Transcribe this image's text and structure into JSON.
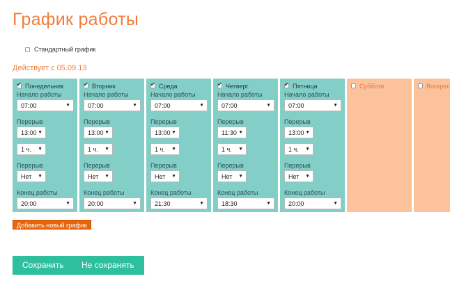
{
  "title": "График работы",
  "standard_schedule": {
    "label": "Стандартный график",
    "checked": false
  },
  "effective_label": "Действует с 05.09.13",
  "labels": {
    "start": "Начало работы",
    "break": "Перерыв",
    "end": "Конец работы"
  },
  "days": [
    {
      "name": "Понедельник",
      "checked": true,
      "start": "07:00",
      "break1": "13:00",
      "duration": "1 ч.",
      "break2": "Нет",
      "end": "20:00"
    },
    {
      "name": "Вторник",
      "checked": true,
      "start": "07:00",
      "break1": "13:00",
      "duration": "1 ч.",
      "break2": "Нет",
      "end": "20:00"
    },
    {
      "name": "Среда",
      "checked": true,
      "start": "07:00",
      "break1": "13:00",
      "duration": "1 ч.",
      "break2": "Нет",
      "end": "21:30"
    },
    {
      "name": "Четверг",
      "checked": true,
      "start": "07:00",
      "break1": "11:30",
      "duration": "1 ч.",
      "break2": "Нет",
      "end": "18:30"
    },
    {
      "name": "Пятница",
      "checked": true,
      "start": "07:00",
      "break1": "13:00",
      "duration": "1 ч.",
      "break2": "Нет",
      "end": "20:00"
    },
    {
      "name": "Суббота",
      "checked": false
    },
    {
      "name": "Воскресенье",
      "checked": false
    }
  ],
  "add_schedule_button": "Добавить новый график",
  "save_button": "Сохранить",
  "dont_save_button": "Не сохранять",
  "colors": {
    "accent_orange": "#f07d3c",
    "work_day": "#83cfc7",
    "day_off": "#fbc29b",
    "button_teal": "#2dbf9e",
    "button_orange": "#e8650a"
  }
}
